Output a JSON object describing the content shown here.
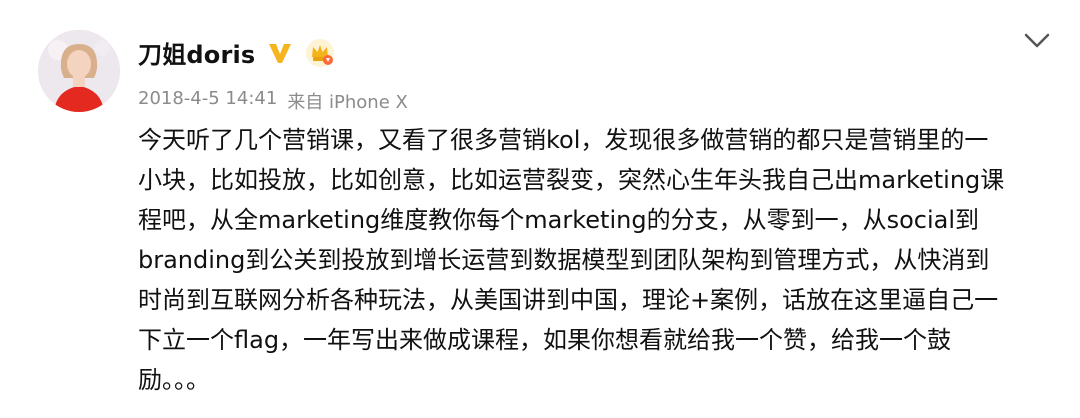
{
  "post": {
    "username": "刀姐doris",
    "badges": {
      "verified_icon": "verified-v-icon",
      "crown_icon": "crown-badge-icon",
      "verified_color": "#f5b51e",
      "crown_color": "#f3b31a"
    },
    "meta": {
      "timestamp": "2018-4-5 14:41",
      "source": "来自 iPhone X"
    },
    "menu_icon": "chevron-down-icon",
    "content_lines": [
      "今天听了几个营销课，又看了很多营销kol，发现很多做营销的都只是营销里的一",
      "小块，比如投放，比如创意，比如运营裂变，突然心生年头我自己出marketing课",
      "程吧，从全marketing维度教你每个marketing的分支，从零到一，从social到",
      "branding到公关到投放到增长运营到数据模型到团队架构到管理方式，从快消到",
      "时尚到互联网分析各种玩法，从美国讲到中国，理论+案例，话放在这里逼自己一",
      "下立一个flag，一年写出来做成课程，如果你想看就给我一个赞，给我一个鼓",
      "励。。。"
    ]
  }
}
